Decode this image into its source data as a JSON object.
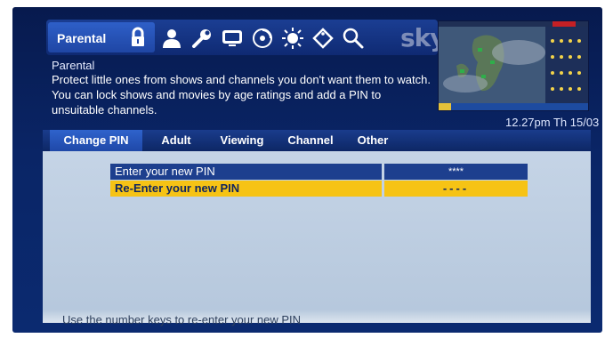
{
  "menu": {
    "active_label": "Parental",
    "icons": [
      "lock-icon",
      "person-icon",
      "wrench-icon",
      "tv-icon",
      "disc-icon",
      "sun-icon",
      "tag-icon",
      "search-icon"
    ],
    "brand": "sky"
  },
  "description": {
    "title": "Parental",
    "body": "Protect little ones from shows and channels you don't want them to watch. You can lock shows and movies by age ratings and add a PIN to unsuitable channels."
  },
  "clock": "12.27pm Th 15/03",
  "tabs": [
    "Change PIN",
    "Adult",
    "Viewing",
    "Channel",
    "Other"
  ],
  "active_tab": "Change PIN",
  "pin_rows": [
    {
      "label": "Enter your new PIN",
      "value": "****",
      "selected": false
    },
    {
      "label": "Re-Enter your new PIN",
      "value": "----",
      "selected": true
    }
  ],
  "hint": "Use the number keys to re-enter your new PIN",
  "colors": {
    "accent_yellow": "#f6c315",
    "row_blue": "#1d3f8e",
    "screen_bg": "#0a2566"
  }
}
